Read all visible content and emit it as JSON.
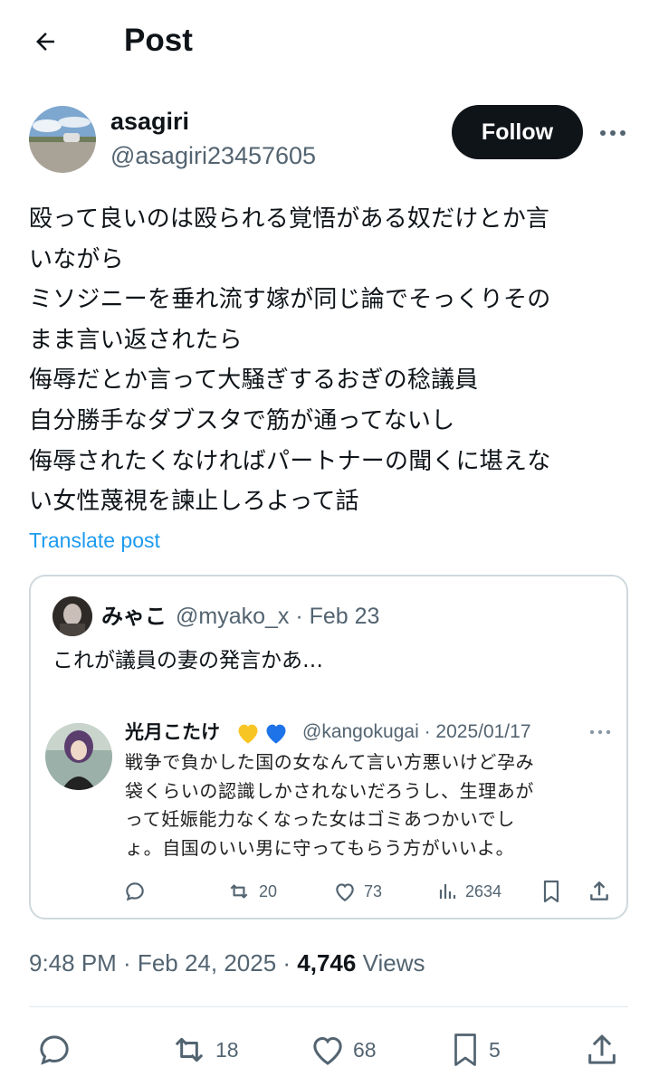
{
  "header": {
    "title": "Post",
    "back_icon": "arrow-left-icon"
  },
  "author": {
    "name": "asagiri",
    "handle": "@asagiri23457605",
    "follow_label": "Follow",
    "more_icon": "more-horizontal-icon"
  },
  "post": {
    "lines": [
      "殴って良いのは殴られる覚悟がある奴だけとか言",
      "いながら",
      "ミソジニーを垂れ流す嫁が同じ論でそっくりその",
      "まま言い返されたら",
      "侮辱だとか言って大騒ぎするおぎの稔議員",
      "自分勝手なダブスタで筋が通ってないし",
      "侮辱されたくなければパートナーの聞くに堪えな",
      "い女性蔑視を諫止しろよって話"
    ],
    "translate_label": "Translate post"
  },
  "quote": {
    "name": "みゃこ",
    "meta": "@myako_x · Feb 23",
    "text": "これが議員の妻の発言かあ…",
    "image": {
      "name": "光月こたけ",
      "meta": "@kangokugai · 2025/01/17",
      "lines": [
        "戦争で負かした国の女なんて言い方悪いけど孕み",
        "袋くらいの認識しかされないだろうし、生理あが",
        "って妊娠能力なくなった女はゴミあつかいでし",
        "ょ。自国のいい男に守ってもらう方がいいよ。"
      ],
      "retweets": "20",
      "likes": "73",
      "views": "2634"
    }
  },
  "timestamp": {
    "time": "9:48 PM · Feb 24, 2025 · ",
    "views_count": "4,746",
    "views_label": " Views"
  },
  "actions": {
    "retweets": "18",
    "likes": "68",
    "bookmarks": "5"
  },
  "colors": {
    "accent": "#1d9bf0",
    "text": "#0f1419",
    "muted": "#536471",
    "border": "#cfd9de"
  }
}
